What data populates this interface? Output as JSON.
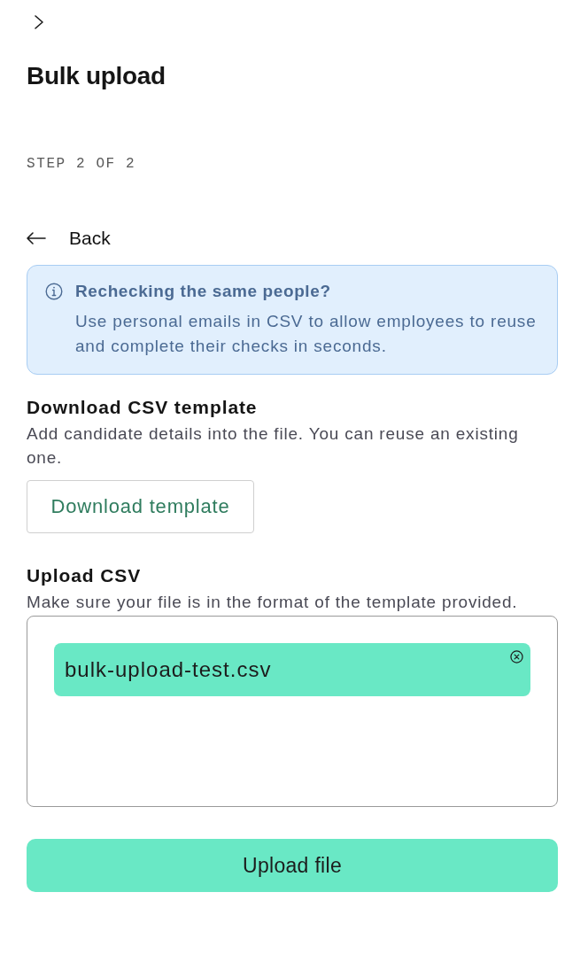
{
  "header": {
    "title": "Bulk upload",
    "step": "STEP 2 OF 2"
  },
  "back_link": {
    "label": "Back"
  },
  "info_banner": {
    "title": "Rechecking the same people?",
    "body": "Use personal emails in CSV to allow employees to reuse and complete their checks in seconds."
  },
  "download_section": {
    "title": "Download CSV template",
    "description": "Add candidate details into the file. You can reuse an existing one.",
    "button": "Download template"
  },
  "upload_section": {
    "title": "Upload CSV",
    "description": "Make sure your file is in the format of the template provided.",
    "files": [
      {
        "name": "bulk-upload-test.csv"
      }
    ],
    "submit_button": "Upload file"
  }
}
